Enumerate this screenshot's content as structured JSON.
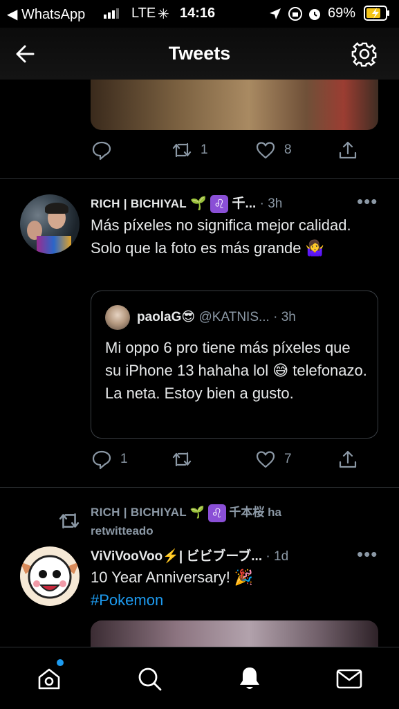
{
  "status_bar": {
    "back_app": "◀ WhatsApp",
    "carrier": "LTE",
    "time": "14:16",
    "battery": "69%"
  },
  "header": {
    "title": "Tweets"
  },
  "tweet1_actions": {
    "retweets": "1",
    "likes": "8"
  },
  "tweet2": {
    "author": "RICH | BICHIYAL",
    "author_suffix": "千...",
    "time": "· 3h",
    "text": "Más píxeles no significa mejor calidad. Solo que la foto es más grande 🤷‍♀️",
    "quote": {
      "name": "paolaG😎",
      "handle": "@KATNIS...",
      "time": "· 3h",
      "text": "Mi oppo 6 pro tiene más píxeles que su iPhone 13 hahaha lol 😅 telefonazo. La neta. Estoy bien a gusto."
    },
    "replies": "1",
    "likes": "7"
  },
  "tweet3": {
    "retweeted_by": "RICH | BICHIYAL",
    "retweeted_suffix": "千本桜 ha retwitteado",
    "author": "ViViVooVoo⚡️| ビビブーブ...",
    "time": "· 1d",
    "text": "10 Year Anniversary! 🎉",
    "hashtag": "#Pokemon"
  },
  "icons": {
    "back": "arrow-left-icon",
    "settings": "gear-icon",
    "reply": "reply-icon",
    "retweet": "retweet-icon",
    "like": "heart-icon",
    "share": "share-icon",
    "home": "home-icon",
    "search": "search-icon",
    "notifications": "bell-icon",
    "messages": "mail-icon"
  },
  "colors": {
    "background": "#000000",
    "link": "#1d9bf0",
    "muted": "#8b98a5",
    "leo_badge": "#8a4fd6"
  }
}
